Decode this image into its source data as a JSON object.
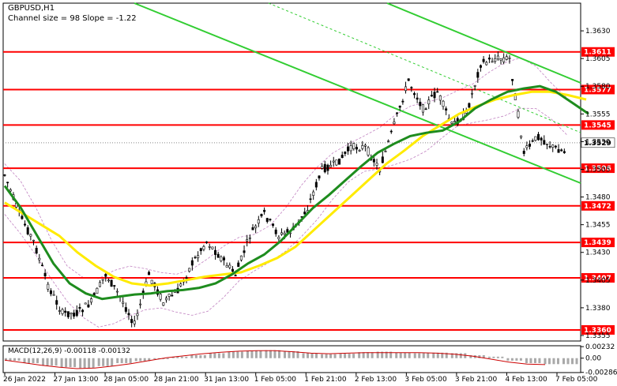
{
  "header": {
    "symbol": "GBPUSD,H1",
    "channel_info": "Channel size = 98 Slope = -1.22",
    "macd_label": "MACD(12,26,9) -0.00118 -0.00132"
  },
  "colors": {
    "level_line": "#ff0000",
    "level_label_bg": "#ff0000",
    "channel_line": "#32cd32",
    "ma_fast": "#1e8c1e",
    "ma_slow": "#ffeb00",
    "bands": "#c080c0",
    "candle": "#000000",
    "macd_hist": "#a9a9a9",
    "macd_signal": "#cc0000"
  },
  "chart_data": {
    "type": "line",
    "instrument": "GBPUSD",
    "timeframe": "H1",
    "ylim": [
      1.335,
      1.3655
    ],
    "y_ticks": [
      "1.3630",
      "1.3605",
      "1.3580",
      "1.3555",
      "1.3530",
      "1.3505",
      "1.3480",
      "1.3455",
      "1.3430",
      "1.3405",
      "1.3380",
      "1.3355"
    ],
    "x_ticks": [
      "26 Jan 2022",
      "27 Jan 13:00",
      "28 Jan 05:00",
      "28 Jan 21:00",
      "31 Jan 13:00",
      "1 Feb 05:00",
      "1 Feb 21:00",
      "2 Feb 13:00",
      "3 Feb 05:00",
      "3 Feb 21:00",
      "4 Feb 13:00",
      "7 Feb 05:00"
    ],
    "levels": [
      "1.3611",
      "1.3577",
      "1.3545",
      "1.3506",
      "1.3472",
      "1.3439",
      "1.3407",
      "1.3360"
    ],
    "current_price": "1.3529",
    "price_series": [
      {
        "name": "close",
        "values": [
          1.35,
          1.3465,
          1.344,
          1.34,
          1.3375,
          1.3375,
          1.3385,
          1.341,
          1.339,
          1.3365,
          1.341,
          1.3385,
          1.3395,
          1.342,
          1.344,
          1.3425,
          1.341,
          1.3445,
          1.3465,
          1.3445,
          1.345,
          1.347,
          1.3505,
          1.351,
          1.3525,
          1.3525,
          1.3505,
          1.3545,
          1.3585,
          1.356,
          1.3575,
          1.3545,
          1.3555,
          1.36,
          1.3605,
          1.3605,
          1.352,
          1.3535,
          1.3525,
          1.352
        ]
      }
    ],
    "ma_fast": [
      1.349,
      1.347,
      1.3445,
      1.342,
      1.3402,
      1.3393,
      1.3388,
      1.339,
      1.3392,
      1.3393,
      1.3395,
      1.3396,
      1.3398,
      1.3402,
      1.341,
      1.342,
      1.3428,
      1.344,
      1.3455,
      1.347,
      1.3482,
      1.3495,
      1.3508,
      1.352,
      1.3528,
      1.3535,
      1.3538,
      1.354,
      1.3548,
      1.356,
      1.3568,
      1.3575,
      1.3578,
      1.358,
      1.3575,
      1.3565,
      1.3555
    ],
    "ma_slow": [
      1.3475,
      1.3465,
      1.3455,
      1.3445,
      1.343,
      1.3418,
      1.3408,
      1.3402,
      1.34,
      1.3402,
      1.3405,
      1.3408,
      1.341,
      1.3412,
      1.3418,
      1.3425,
      1.3435,
      1.345,
      1.3465,
      1.348,
      1.3495,
      1.351,
      1.3522,
      1.3535,
      1.3545,
      1.3555,
      1.3562,
      1.3568,
      1.3572,
      1.3575,
      1.3575,
      1.3572,
      1.3568
    ],
    "macd": {
      "ylim": [
        -0.0029,
        0.0025
      ],
      "y_ticks": [
        "0.00232",
        "0.00",
        "-0.00286"
      ],
      "histogram": [
        -0.0005,
        -0.001,
        -0.0015,
        -0.0018,
        -0.002,
        -0.0016,
        -0.001,
        -0.0006,
        -0.0002,
        0.0003,
        0.0006,
        0.001,
        0.0013,
        0.0015,
        0.0016,
        0.0014,
        0.001,
        0.0008,
        0.0009,
        0.0012,
        0.0013,
        0.0011,
        0.001,
        0.0011,
        0.001,
        0.0006,
        0.0003,
        -0.0005,
        -0.001,
        -0.0012,
        -0.0012
      ],
      "signal": [
        -0.0004,
        -0.0009,
        -0.0014,
        -0.0018,
        -0.0021,
        -0.002,
        -0.0016,
        -0.0011,
        -0.0005,
        0.0001,
        0.0005,
        0.0009,
        0.0012,
        0.0014,
        0.0015,
        0.0015,
        0.0013,
        0.001,
        0.0009,
        0.001,
        0.0011,
        0.0011,
        0.0011,
        0.0011,
        0.001,
        0.0008,
        0.0004,
        -0.0002,
        -0.0008,
        -0.0012,
        -0.0013
      ]
    }
  }
}
